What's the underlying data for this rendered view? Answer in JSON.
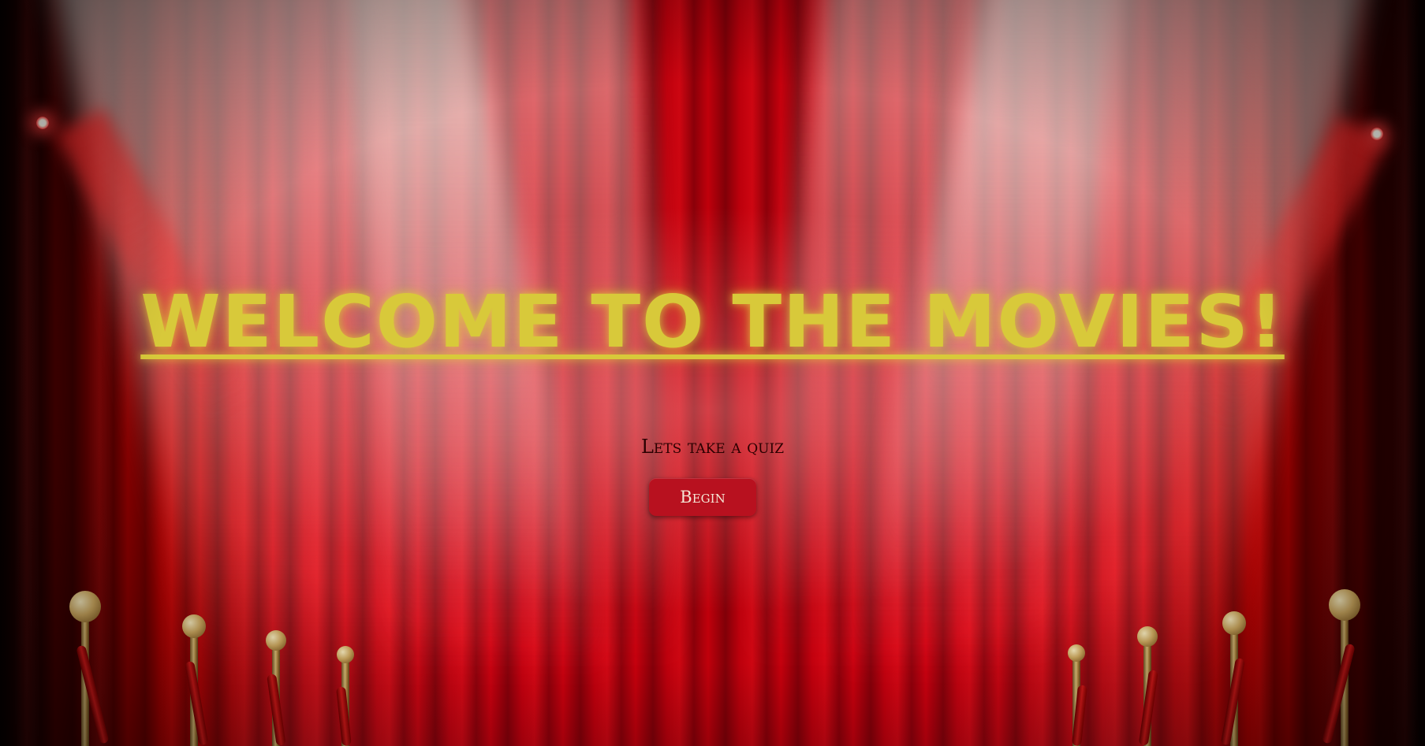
{
  "page": {
    "title": "Welcome to the Movies!",
    "subtitle": "Lets take a quiz",
    "begin_label": "Begin"
  },
  "theme": {
    "title_color": "#d8c93a",
    "button_color": "#b8111f",
    "curtain_color": "#d80010",
    "stanchion_color": "#d6b064",
    "rope_color": "#e01a1a"
  },
  "decor": {
    "background": "red-theater-curtain",
    "spotlights": [
      "spotlight-icon",
      "spotlight-icon"
    ],
    "stanchions": "velvet-rope-stanchions"
  }
}
